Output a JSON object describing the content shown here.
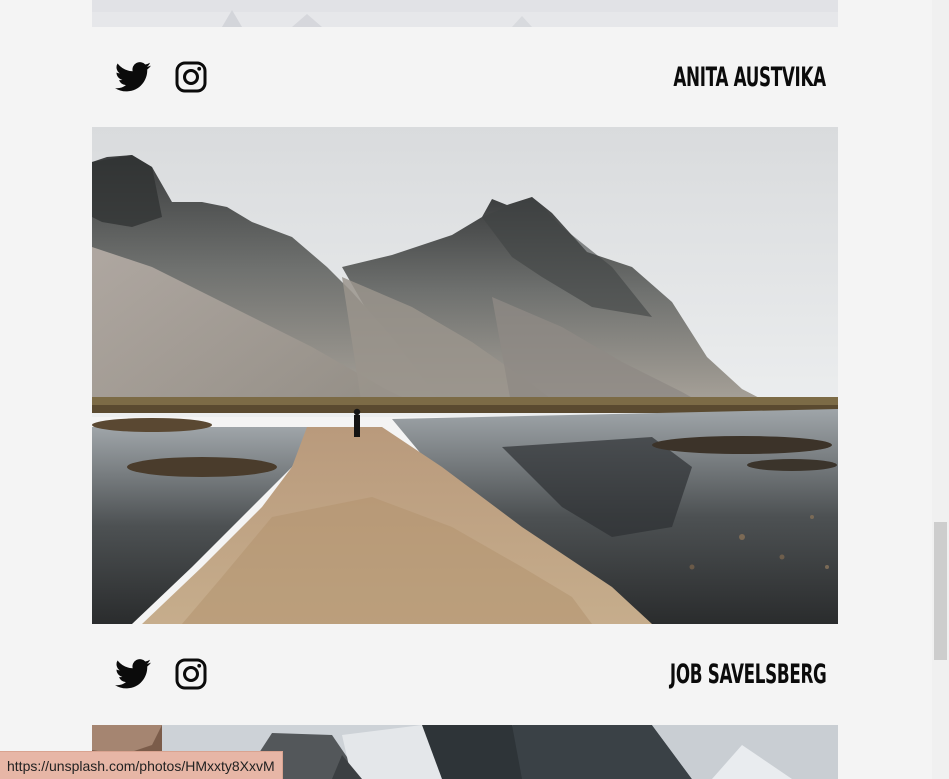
{
  "cards": [
    {
      "author": "Anita Austvika",
      "social": [
        {
          "icon": "twitter-icon"
        },
        {
          "icon": "instagram-icon"
        }
      ]
    },
    {
      "author": "Job Savelsberg",
      "social": [
        {
          "icon": "twitter-icon"
        },
        {
          "icon": "instagram-icon"
        }
      ]
    }
  ],
  "photos": [
    {
      "icon": "snowy-ground-photo"
    },
    {
      "icon": "mountain-lake-path-photo"
    },
    {
      "icon": "snowy-forest-valley-photo"
    }
  ],
  "status_bar": {
    "url": "https://unsplash.com/photos/HMxxty8XxvM"
  },
  "colors": {
    "background": "#f4f4f4",
    "text": "#0b0b0b",
    "status_bar": "#e7b6a6"
  }
}
